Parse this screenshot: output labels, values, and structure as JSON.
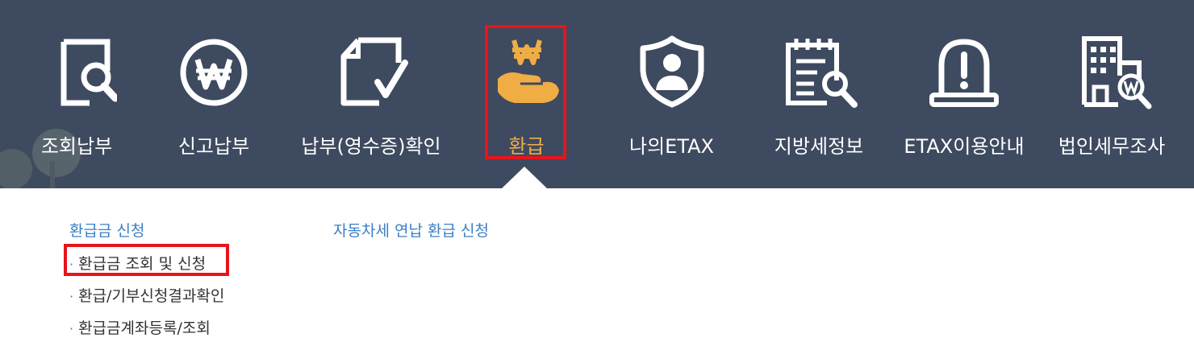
{
  "nav": {
    "items": [
      {
        "label": "조회납부",
        "icon": "search-document-icon"
      },
      {
        "label": "신고납부",
        "icon": "won-circle-icon"
      },
      {
        "label": "납부(영수증)확인",
        "icon": "receipt-check-icon"
      },
      {
        "label": "환급",
        "icon": "refund-hand-won-icon"
      },
      {
        "label": "나의ETAX",
        "icon": "user-shield-icon"
      },
      {
        "label": "지방세정보",
        "icon": "notepad-search-icon"
      },
      {
        "label": "ETAX이용안내",
        "icon": "alert-beacon-icon"
      },
      {
        "label": "법인세무조사",
        "icon": "building-won-search-icon"
      }
    ],
    "active_index": 3
  },
  "submenu": {
    "group1": {
      "title": "환급금 신청",
      "links": [
        "환급금 조회 및 신청",
        "환급/기부신청결과확인",
        "환급금계좌등록/조회"
      ]
    },
    "group2": {
      "title": "자동차세 연납 환급 신청"
    }
  },
  "colors": {
    "nav_bg": "#3e4a5f",
    "active": "#f0ad44",
    "highlight": "#e8141c",
    "link_title": "#3a7fc4"
  }
}
